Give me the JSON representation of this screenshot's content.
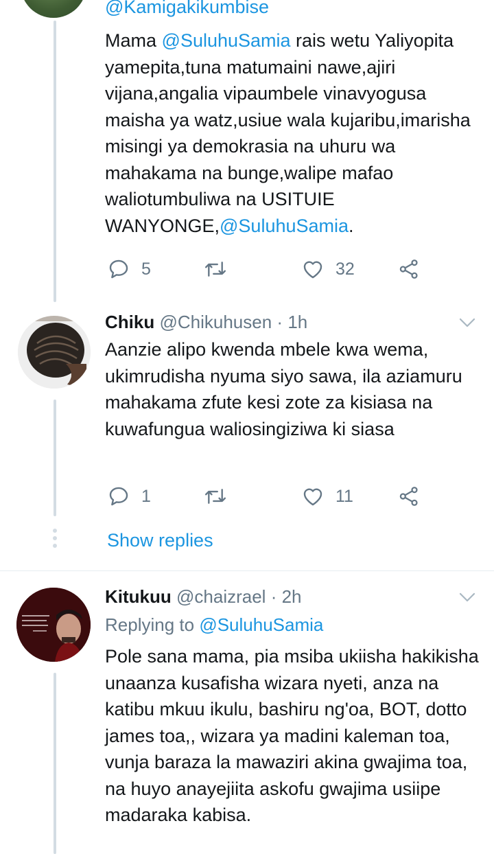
{
  "tweet1": {
    "handle_partial": "@Kamigakikumbise",
    "text_parts": [
      "Mama ",
      "@SuluhuSamia",
      " rais wetu Yaliyopita yamepita,tuna matumaini nawe,ajiri vijana,angalia vipaumbele vinavyogusa maisha ya watz,usiue wala kujaribu,imarisha misingi ya demokrasia na uhuru wa mahakama na bunge,walipe mafao waliotumbuliwa na USITUIE WANYONGE,",
      "@SuluhuSamia",
      "."
    ],
    "replies": "5",
    "retweets": "",
    "likes": "32"
  },
  "tweet2": {
    "name": "Chiku",
    "handle": "@Chikuhusen",
    "sep": "·",
    "time": "1h",
    "text": "Aanzie alipo kwenda mbele kwa wema, ukimrudisha nyuma siyo sawa, ila aziamuru mahakama zfute kesi zote za kisiasa na kuwafungua waliosingiziwa ki siasa",
    "replies": "1",
    "retweets": "",
    "likes": "11",
    "show_replies": "Show replies"
  },
  "tweet3": {
    "name": "Kitukuu",
    "handle": "@chaizrael",
    "sep": "·",
    "time": "2h",
    "replying_prefix": "Replying to ",
    "replying_to": "@SuluhuSamia",
    "text": "Pole sana mama, pia msiba ukiisha hakikisha unaanza kusafisha wizara nyeti, anza na katibu mkuu ikulu, bashiru ng'oa, BOT, dotto james toa,, wizara ya madini kaleman toa,  vunja baraza la mawaziri akina gwajima toa, na huyo anayejiita askofu gwajima usiipe madaraka kabisa."
  },
  "colors": {
    "link": "#1b95e0",
    "secondary_text": "#657786",
    "thread_line": "#d3dce3",
    "divider": "#e6ecf0"
  },
  "icons": [
    "reply-icon",
    "retweet-icon",
    "like-icon",
    "share-icon",
    "chevron-down-icon"
  ]
}
